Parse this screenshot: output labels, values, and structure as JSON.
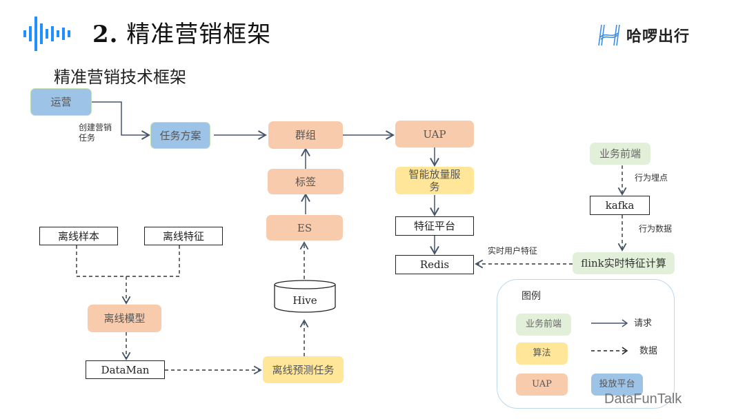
{
  "header": {
    "title_number": "2.",
    "title_text": "精准营销框架",
    "subtitle": "精准营销技术框架",
    "brand_name": "哈啰出行",
    "brand_color": "#1e90ff"
  },
  "nodes": {
    "ops": "运营",
    "task_plan": "任务方案",
    "group": "群组",
    "uap": "UAP",
    "smart_volume": "智能放量服务",
    "feature_platform": "特征平台",
    "redis": "Redis",
    "tag": "标签",
    "es": "ES",
    "hive": "Hive",
    "offline_sample": "离线样本",
    "offline_feature": "离线特征",
    "offline_model": "离线模型",
    "dataman": "DataMan",
    "offline_predict": "离线预测任务",
    "biz_frontend": "业务前端",
    "kafka": "kafka",
    "flink": "flink实时特征计算"
  },
  "edge_labels": {
    "create_task": "创建营销任务",
    "behavior_tracking": "行为埋点",
    "behavior_data": "行为数据",
    "realtime_user_feature": "实时用户特征"
  },
  "legend": {
    "title": "图例",
    "items": [
      {
        "label": "业务前端",
        "color": "#e2f0d9"
      },
      {
        "label": "算法",
        "color": "#ffe699"
      },
      {
        "label": "UAP",
        "color": "#f8cbad"
      },
      {
        "label": "投放平台",
        "color": "#9dc3e6"
      }
    ],
    "request_label": "请求",
    "data_label": "数据"
  },
  "watermark": "DataFunTalk",
  "colors": {
    "blue": "#9dc3e6",
    "orange": "#f8cbad",
    "yellow": "#ffe699",
    "green": "#e2f0d9",
    "arrow": "#44546a"
  }
}
